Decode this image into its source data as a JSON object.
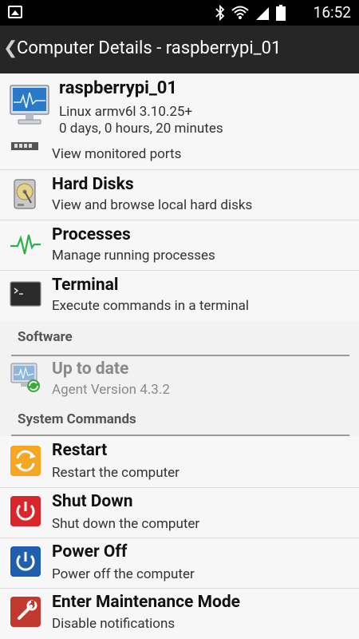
{
  "status_bar": {
    "time": "16:52"
  },
  "action_bar": {
    "title": "Computer Details - raspberrypi_01"
  },
  "computer": {
    "name": "raspberrypi_01",
    "os": "Linux armv6l 3.10.25+",
    "uptime": "0 days, 0 hours, 20 minutes"
  },
  "items": {
    "ports": {
      "sub": "View monitored ports"
    },
    "disks": {
      "title": "Hard Disks",
      "sub": "View and browse local hard disks"
    },
    "processes": {
      "title": "Processes",
      "sub": "Manage running processes"
    },
    "terminal": {
      "title": "Terminal",
      "sub": "Execute commands in a terminal"
    }
  },
  "sections": {
    "software": "Software",
    "system_commands": "System Commands"
  },
  "software": {
    "title": "Up to date",
    "sub": "Agent Version 4.3.2"
  },
  "commands": {
    "restart": {
      "title": "Restart",
      "sub": "Restart the computer"
    },
    "shutdown": {
      "title": "Shut Down",
      "sub": "Shut down the computer"
    },
    "poweroff": {
      "title": "Power Off",
      "sub": "Power off the computer"
    },
    "maintenance": {
      "title": "Enter Maintenance Mode",
      "sub": "Disable notifications"
    }
  },
  "colors": {
    "actionbar": "#262626",
    "restart": "#f5a623",
    "shutdown": "#d8262b",
    "poweroff": "#1f5fae",
    "maintenance": "#c2392f",
    "pulse": "#2bb34a"
  }
}
